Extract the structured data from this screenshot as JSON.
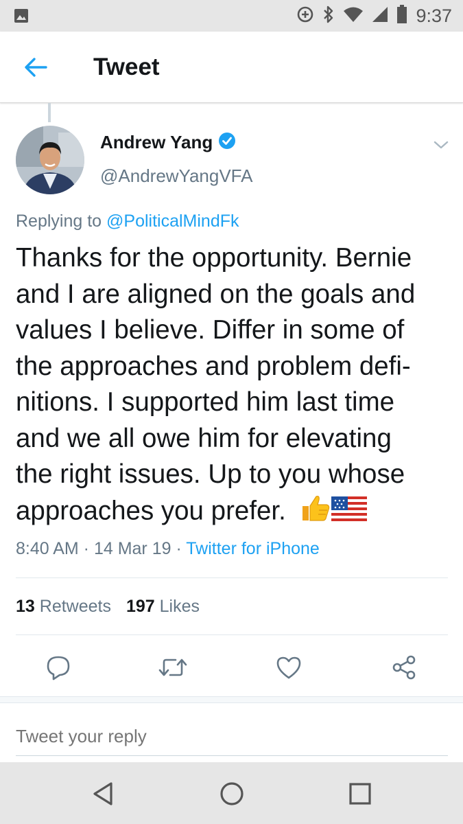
{
  "status_bar": {
    "time": "9:37",
    "icons": [
      "image-icon",
      "data-saver-icon",
      "bluetooth-icon",
      "wifi-icon",
      "signal-icon",
      "battery-icon"
    ]
  },
  "header": {
    "title": "Tweet",
    "back_icon": "back-arrow-icon"
  },
  "tweet": {
    "author_name": "Andrew Yang",
    "verified": true,
    "handle": "@AndrewYangVFA",
    "replying_prefix": "Replying to ",
    "replying_to": "@PoliticalMindFk",
    "body_lines": [
      "Thanks for the opportunity.  Bernie",
      "and I are aligned on the goals and",
      "values I believe. Differ in some of",
      "the approaches and problem defi-",
      "nitions.  I supported him last time",
      "and we all owe him for elevating",
      "the right issues. Up to you whose",
      "approaches you prefer."
    ],
    "emojis": [
      "thumbs-up-emoji",
      "us-flag-emoji"
    ],
    "time": "8:40 AM",
    "date": "14 Mar 19",
    "separator": " · ",
    "source": "Twitter for iPhone"
  },
  "stats": {
    "retweets_count": "13",
    "retweets_label": "Retweets",
    "likes_count": "197",
    "likes_label": "Likes"
  },
  "actions": [
    "reply-icon",
    "retweet-icon",
    "like-icon",
    "share-icon"
  ],
  "reply_box": {
    "placeholder": "Tweet your reply"
  },
  "nav": [
    "back-triangle-icon",
    "home-circle-icon",
    "recents-square-icon"
  ],
  "colors": {
    "accent": "#1da1f2",
    "text": "#14171a",
    "secondary": "#657786",
    "status_bar_bg": "#e6e6e6"
  }
}
